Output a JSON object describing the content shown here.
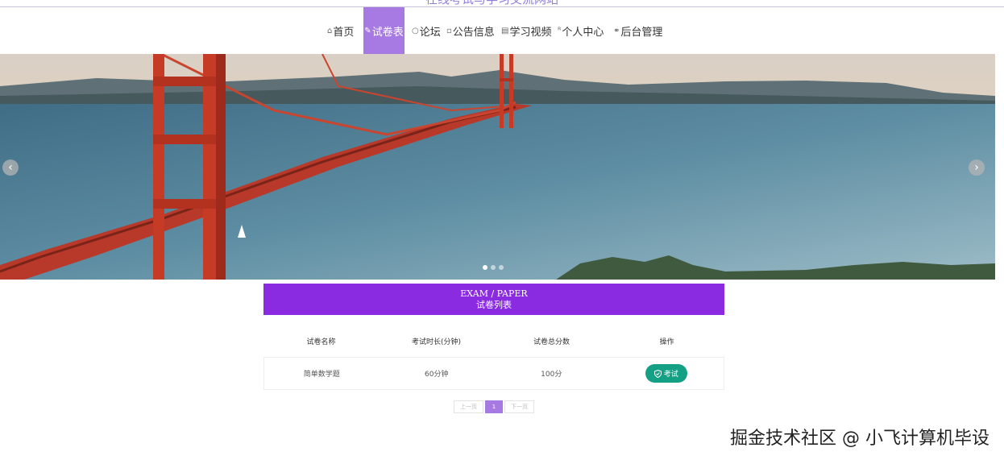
{
  "site_title": "在线考试与学习交流网站",
  "nav": {
    "items": [
      {
        "icon": "home-icon",
        "glyph": "⌂",
        "label": "首页"
      },
      {
        "icon": "paper-icon",
        "glyph": "✎",
        "label": "试卷表"
      },
      {
        "icon": "chat-icon",
        "glyph": "○",
        "label": "论坛"
      },
      {
        "icon": "notice-icon",
        "glyph": "▫",
        "label": "公告信息"
      },
      {
        "icon": "video-icon",
        "glyph": "▤",
        "label": "学习视频"
      },
      {
        "icon": "user-icon",
        "glyph": "ᴿ",
        "label": "个人中心"
      },
      {
        "icon": "link-icon",
        "glyph": "⚭",
        "label": "后台管理"
      }
    ],
    "active_index": 1
  },
  "carousel": {
    "prev_glyph": "‹",
    "next_glyph": "›",
    "slide_count": 3,
    "active_slide": 1
  },
  "section": {
    "title_en": "EXAM / PAPER",
    "title_cn": "试卷列表"
  },
  "table": {
    "columns": [
      "试卷名称",
      "考试时长(分钟)",
      "试卷总分数",
      "操作"
    ],
    "rows": [
      {
        "name": "简单数学题",
        "duration": "60分钟",
        "score": "100分",
        "action": "考试"
      }
    ]
  },
  "pagination": {
    "prev_label": "上一页",
    "current": "1",
    "next_label": "下一页"
  },
  "watermark": "掘金技术社区 @ 小飞计算机毕设",
  "colors": {
    "nav_active": "#a77ae3",
    "section_header": "#8a2be2",
    "exam_button": "#14a085"
  }
}
